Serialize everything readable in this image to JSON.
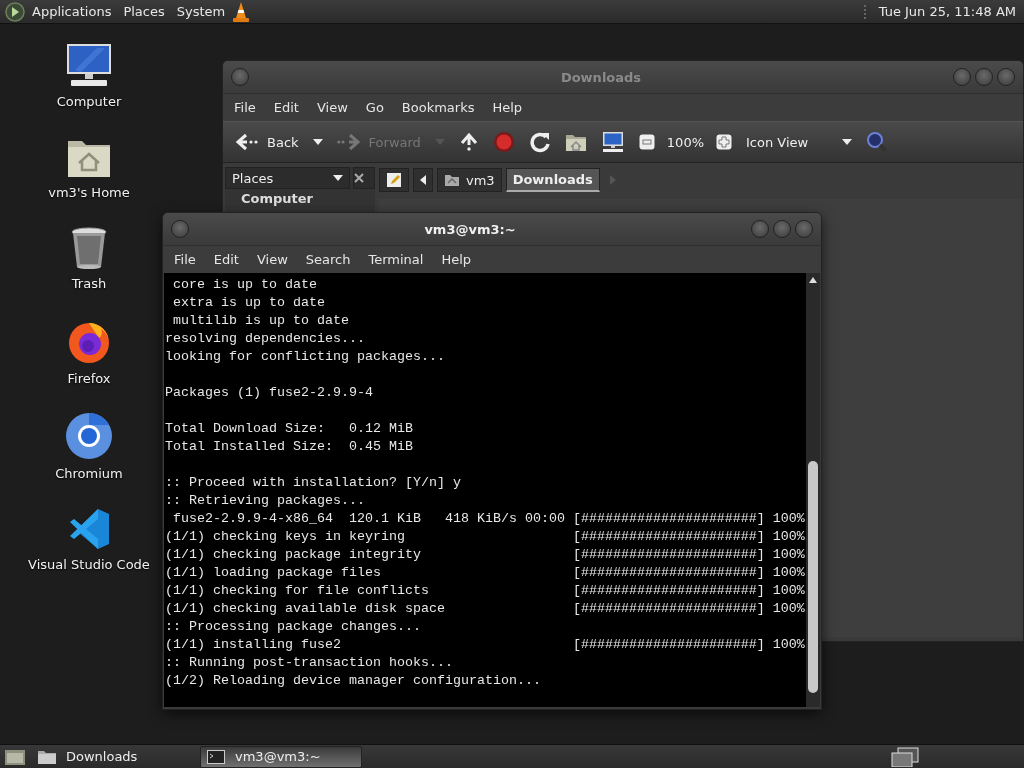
{
  "top_panel": {
    "menus": [
      "Applications",
      "Places",
      "System"
    ],
    "clock": "Tue Jun 25, 11:48 AM"
  },
  "desktop_icons": [
    {
      "kind": "computer",
      "label": "Computer"
    },
    {
      "kind": "home",
      "label": "vm3's Home"
    },
    {
      "kind": "trash",
      "label": "Trash"
    },
    {
      "kind": "firefox",
      "label": "Firefox"
    },
    {
      "kind": "chromium",
      "label": "Chromium"
    },
    {
      "kind": "vscode",
      "label": "Visual Studio Code"
    }
  ],
  "file_manager": {
    "title": "Downloads",
    "active": false,
    "menu": [
      "File",
      "Edit",
      "View",
      "Go",
      "Bookmarks",
      "Help"
    ],
    "toolbar": {
      "back": "Back",
      "forward": "Forward",
      "forward_disabled": true,
      "zoom": "100%",
      "view": "Icon View"
    },
    "sidebar": {
      "header": "Places",
      "items": [
        "Computer"
      ]
    },
    "path": [
      {
        "label": "vm3",
        "selected": false
      },
      {
        "label": "Downloads",
        "selected": true
      }
    ]
  },
  "terminal": {
    "title": "vm3@vm3:~",
    "active": true,
    "menu": [
      "File",
      "Edit",
      "View",
      "Search",
      "Terminal",
      "Help"
    ],
    "blocks": [
      [
        {
          "text": " core is up to date"
        },
        {
          "text": " extra is up to date"
        },
        {
          "text": " multilib is up to date"
        },
        {
          "text": "resolving dependencies..."
        },
        {
          "text": "looking for conflicting packages..."
        }
      ],
      [
        {
          "text": "Packages (1) fuse2-2.9.9-4"
        }
      ],
      [
        {
          "text": "Total Download Size:   0.12 MiB"
        },
        {
          "text": "Total Installed Size:  0.45 MiB"
        }
      ],
      [
        {
          "text": ":: Proceed with installation? [Y/n] y"
        },
        {
          "text": ":: Retrieving packages..."
        },
        {
          "text": " fuse2-2.9.9-4-x86_64  120.1 KiB   418 KiB/s 00:00",
          "progress": "[######################] 100%"
        },
        {
          "text": "(1/1) checking keys in keyring",
          "progress": "[######################] 100%"
        },
        {
          "text": "(1/1) checking package integrity",
          "progress": "[######################] 100%"
        },
        {
          "text": "(1/1) loading package files",
          "progress": "[######################] 100%"
        },
        {
          "text": "(1/1) checking for file conflicts",
          "progress": "[######################] 100%"
        },
        {
          "text": "(1/1) checking available disk space",
          "progress": "[######################] 100%"
        },
        {
          "text": ":: Processing package changes..."
        },
        {
          "text": "(1/1) installing fuse2",
          "progress": "[######################] 100%"
        },
        {
          "text": ":: Running post-transaction hooks..."
        },
        {
          "text": "(1/2) Reloading device manager configuration..."
        }
      ]
    ]
  },
  "taskbar": {
    "items": [
      {
        "kind": "folder",
        "label": "Downloads",
        "selected": false
      },
      {
        "kind": "terminal",
        "label": "vm3@vm3:~",
        "selected": true
      }
    ]
  }
}
